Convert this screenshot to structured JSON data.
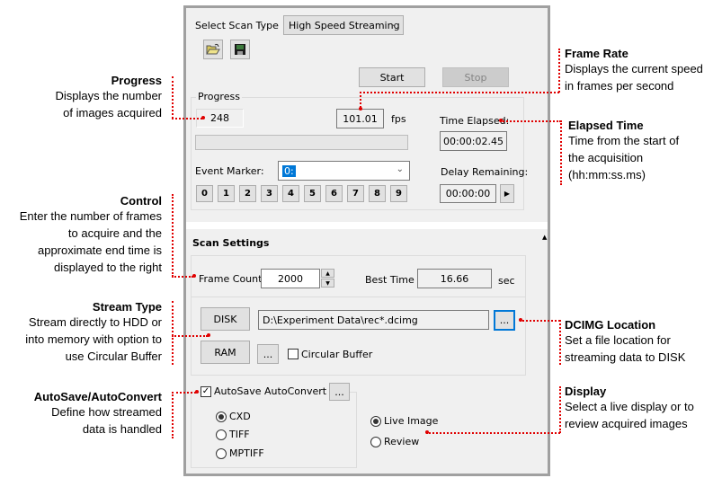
{
  "scan_type": {
    "label": "Select Scan Type",
    "selected": "High Speed Streaming"
  },
  "toolbar": {
    "open_icon": "folder-open-icon",
    "save_icon": "floppy-save-icon"
  },
  "controls": {
    "start_label": "Start",
    "stop_label": "Stop"
  },
  "progress": {
    "group_label": "Progress",
    "images_acquired": "248",
    "frame_rate": "101.01",
    "frame_rate_unit": "fps",
    "time_elapsed_label": "Time Elapsed:",
    "time_elapsed": "00:00:02.45",
    "event_marker_label": "Event Marker:",
    "event_marker_value": "0:",
    "delay_remaining_label": "Delay Remaining:",
    "delay_remaining": "00:00:00",
    "marker_buttons": [
      "0",
      "1",
      "2",
      "3",
      "4",
      "5",
      "6",
      "7",
      "8",
      "9"
    ]
  },
  "scan_settings": {
    "title": "Scan Settings",
    "frame_count_label": "Frame Count",
    "frame_count": "2000",
    "best_time_label": "Best Time",
    "best_time": "16.66",
    "best_time_unit": "sec",
    "disk_label": "DISK",
    "disk_path": "D:\\Experiment Data\\rec*.dcimg",
    "browse_label": "...",
    "ram_label": "RAM",
    "circular_buffer_label": "Circular Buffer",
    "circular_buffer_checked": false,
    "autosave_label": "AutoSave AutoConvert",
    "autosave_checked": true,
    "formats": [
      {
        "label": "CXD",
        "selected": true
      },
      {
        "label": "TIFF",
        "selected": false
      },
      {
        "label": "MPTIFF",
        "selected": false
      }
    ],
    "display_modes": [
      {
        "label": "Live Image",
        "selected": true
      },
      {
        "label": "Review",
        "selected": false
      }
    ]
  },
  "annotations": {
    "progress": {
      "title": "Progress",
      "lines": [
        "Displays the number",
        "of images acquired"
      ]
    },
    "control": {
      "title": "Control",
      "lines": [
        "Enter the number of frames",
        "to acquire and the",
        "approximate end time is",
        "displayed to the right"
      ]
    },
    "stream_type": {
      "title": "Stream Type",
      "lines": [
        "Stream directly to HDD or",
        "into memory with option to",
        "use Circular Buffer"
      ]
    },
    "autosave": {
      "title": "AutoSave/AutoConvert",
      "lines": [
        "Define how streamed",
        "data is handled"
      ]
    },
    "frame_rate": {
      "title": "Frame Rate",
      "lines": [
        "Displays the current speed",
        "in frames per second"
      ]
    },
    "elapsed_time": {
      "title": "Elapsed Time",
      "lines": [
        "Time from the start of",
        "the acquisition",
        "(hh:mm:ss.ms)"
      ]
    },
    "dcimg_location": {
      "title": "DCIMG Location",
      "lines": [
        "Set a file location for",
        "streaming data to DISK"
      ]
    },
    "display": {
      "title": "Display",
      "lines": [
        "Select a live display or to",
        "review acquired images"
      ]
    }
  },
  "colors": {
    "annotation_line": "#e00000",
    "focus_blue": "#0078d7",
    "selection_blue": "#0078d7"
  }
}
